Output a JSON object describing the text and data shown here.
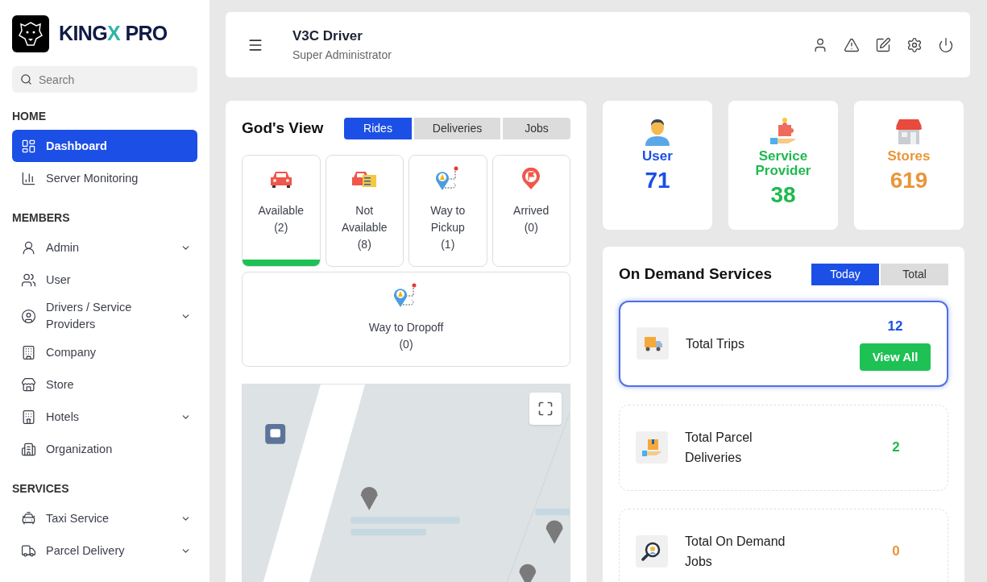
{
  "brand": {
    "name_main": "KINGX",
    "name_accent": "PRO"
  },
  "search": {
    "placeholder": "Search"
  },
  "sidebar": {
    "sections": [
      {
        "title": "HOME",
        "items": [
          {
            "label": "Dashboard",
            "selected": true,
            "expandable": false
          },
          {
            "label": "Server Monitoring",
            "selected": false,
            "expandable": false
          }
        ]
      },
      {
        "title": "MEMBERS",
        "items": [
          {
            "label": "Admin",
            "selected": false,
            "expandable": true
          },
          {
            "label": "User",
            "selected": false,
            "expandable": false
          },
          {
            "label": "Drivers / Service Providers",
            "selected": false,
            "expandable": true
          },
          {
            "label": "Company",
            "selected": false,
            "expandable": false
          },
          {
            "label": "Store",
            "selected": false,
            "expandable": false
          },
          {
            "label": "Hotels",
            "selected": false,
            "expandable": true
          },
          {
            "label": "Organization",
            "selected": false,
            "expandable": false
          }
        ]
      },
      {
        "title": "SERVICES",
        "items": [
          {
            "label": "Taxi Service",
            "selected": false,
            "expandable": true
          },
          {
            "label": "Parcel Delivery",
            "selected": false,
            "expandable": true
          }
        ]
      }
    ]
  },
  "header": {
    "title": "V3C Driver",
    "subtitle": "Super Administrator"
  },
  "gods_view": {
    "title": "God's View",
    "tabs": [
      {
        "label": "Rides",
        "selected": true
      },
      {
        "label": "Deliveries",
        "selected": false
      },
      {
        "label": "Jobs",
        "selected": false
      }
    ],
    "statuses": [
      {
        "kind": "car",
        "label": "Available",
        "count": "(2)",
        "selected": true
      },
      {
        "kind": "car-list",
        "label": "Not Available",
        "count": "(8)",
        "selected": false
      },
      {
        "kind": "route",
        "label": "Way to Pickup",
        "count": "(1)",
        "selected": false
      },
      {
        "kind": "flag",
        "label": "Arrived",
        "count": "(0)",
        "selected": false
      },
      {
        "kind": "route",
        "label": "Way to Dropoff",
        "count": "(0)",
        "selected": false
      }
    ]
  },
  "stats": [
    {
      "kind": "user",
      "label": "User",
      "value": "71",
      "color": "#1a4fe6"
    },
    {
      "kind": "provider",
      "label": "Service Provider",
      "value": "38",
      "color": "#20b94f"
    },
    {
      "kind": "store",
      "label": "Stores",
      "value": "619",
      "color": "#e8963a"
    }
  ],
  "on_demand": {
    "title": "On Demand Services",
    "tabs": [
      {
        "label": "Today",
        "selected": true
      },
      {
        "label": "Total",
        "selected": false
      }
    ],
    "items": [
      {
        "kind": "trips",
        "label": "Total Trips",
        "value": "12",
        "color": "#1a4fe6",
        "selected": true,
        "button": "View All"
      },
      {
        "kind": "parcel",
        "label": "Total Parcel Deliveries",
        "value": "2",
        "color": "#20b94f",
        "selected": false
      },
      {
        "kind": "jobs",
        "label": "Total On Demand Jobs",
        "value": "0",
        "color": "#e8963a",
        "selected": false
      }
    ]
  }
}
